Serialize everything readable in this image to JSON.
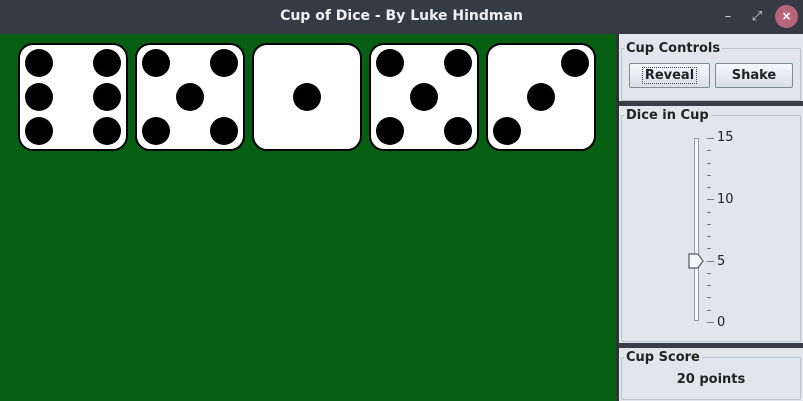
{
  "window": {
    "title": "Cup of Dice - By Luke Hindman",
    "minimize_glyph": "–",
    "maximize_glyph": "⤢",
    "close_glyph": "×"
  },
  "dice": [
    6,
    5,
    1,
    5,
    3
  ],
  "controls": {
    "legend": "Cup Controls",
    "reveal_label": "Reveal",
    "shake_label": "Shake"
  },
  "slider": {
    "legend": "Dice in Cup",
    "min": 0,
    "max": 15,
    "value": 5,
    "labels": [
      "15",
      "10",
      "5",
      "0"
    ]
  },
  "score": {
    "legend": "Cup Score",
    "text": "20 points"
  },
  "colors": {
    "table": "#075f14",
    "titlebar": "#363a44",
    "die_face": "#ffffff",
    "pip": "#000000"
  },
  "icons": {
    "minimize": "minimize-icon",
    "maximize": "maximize-icon",
    "close": "close-icon"
  }
}
